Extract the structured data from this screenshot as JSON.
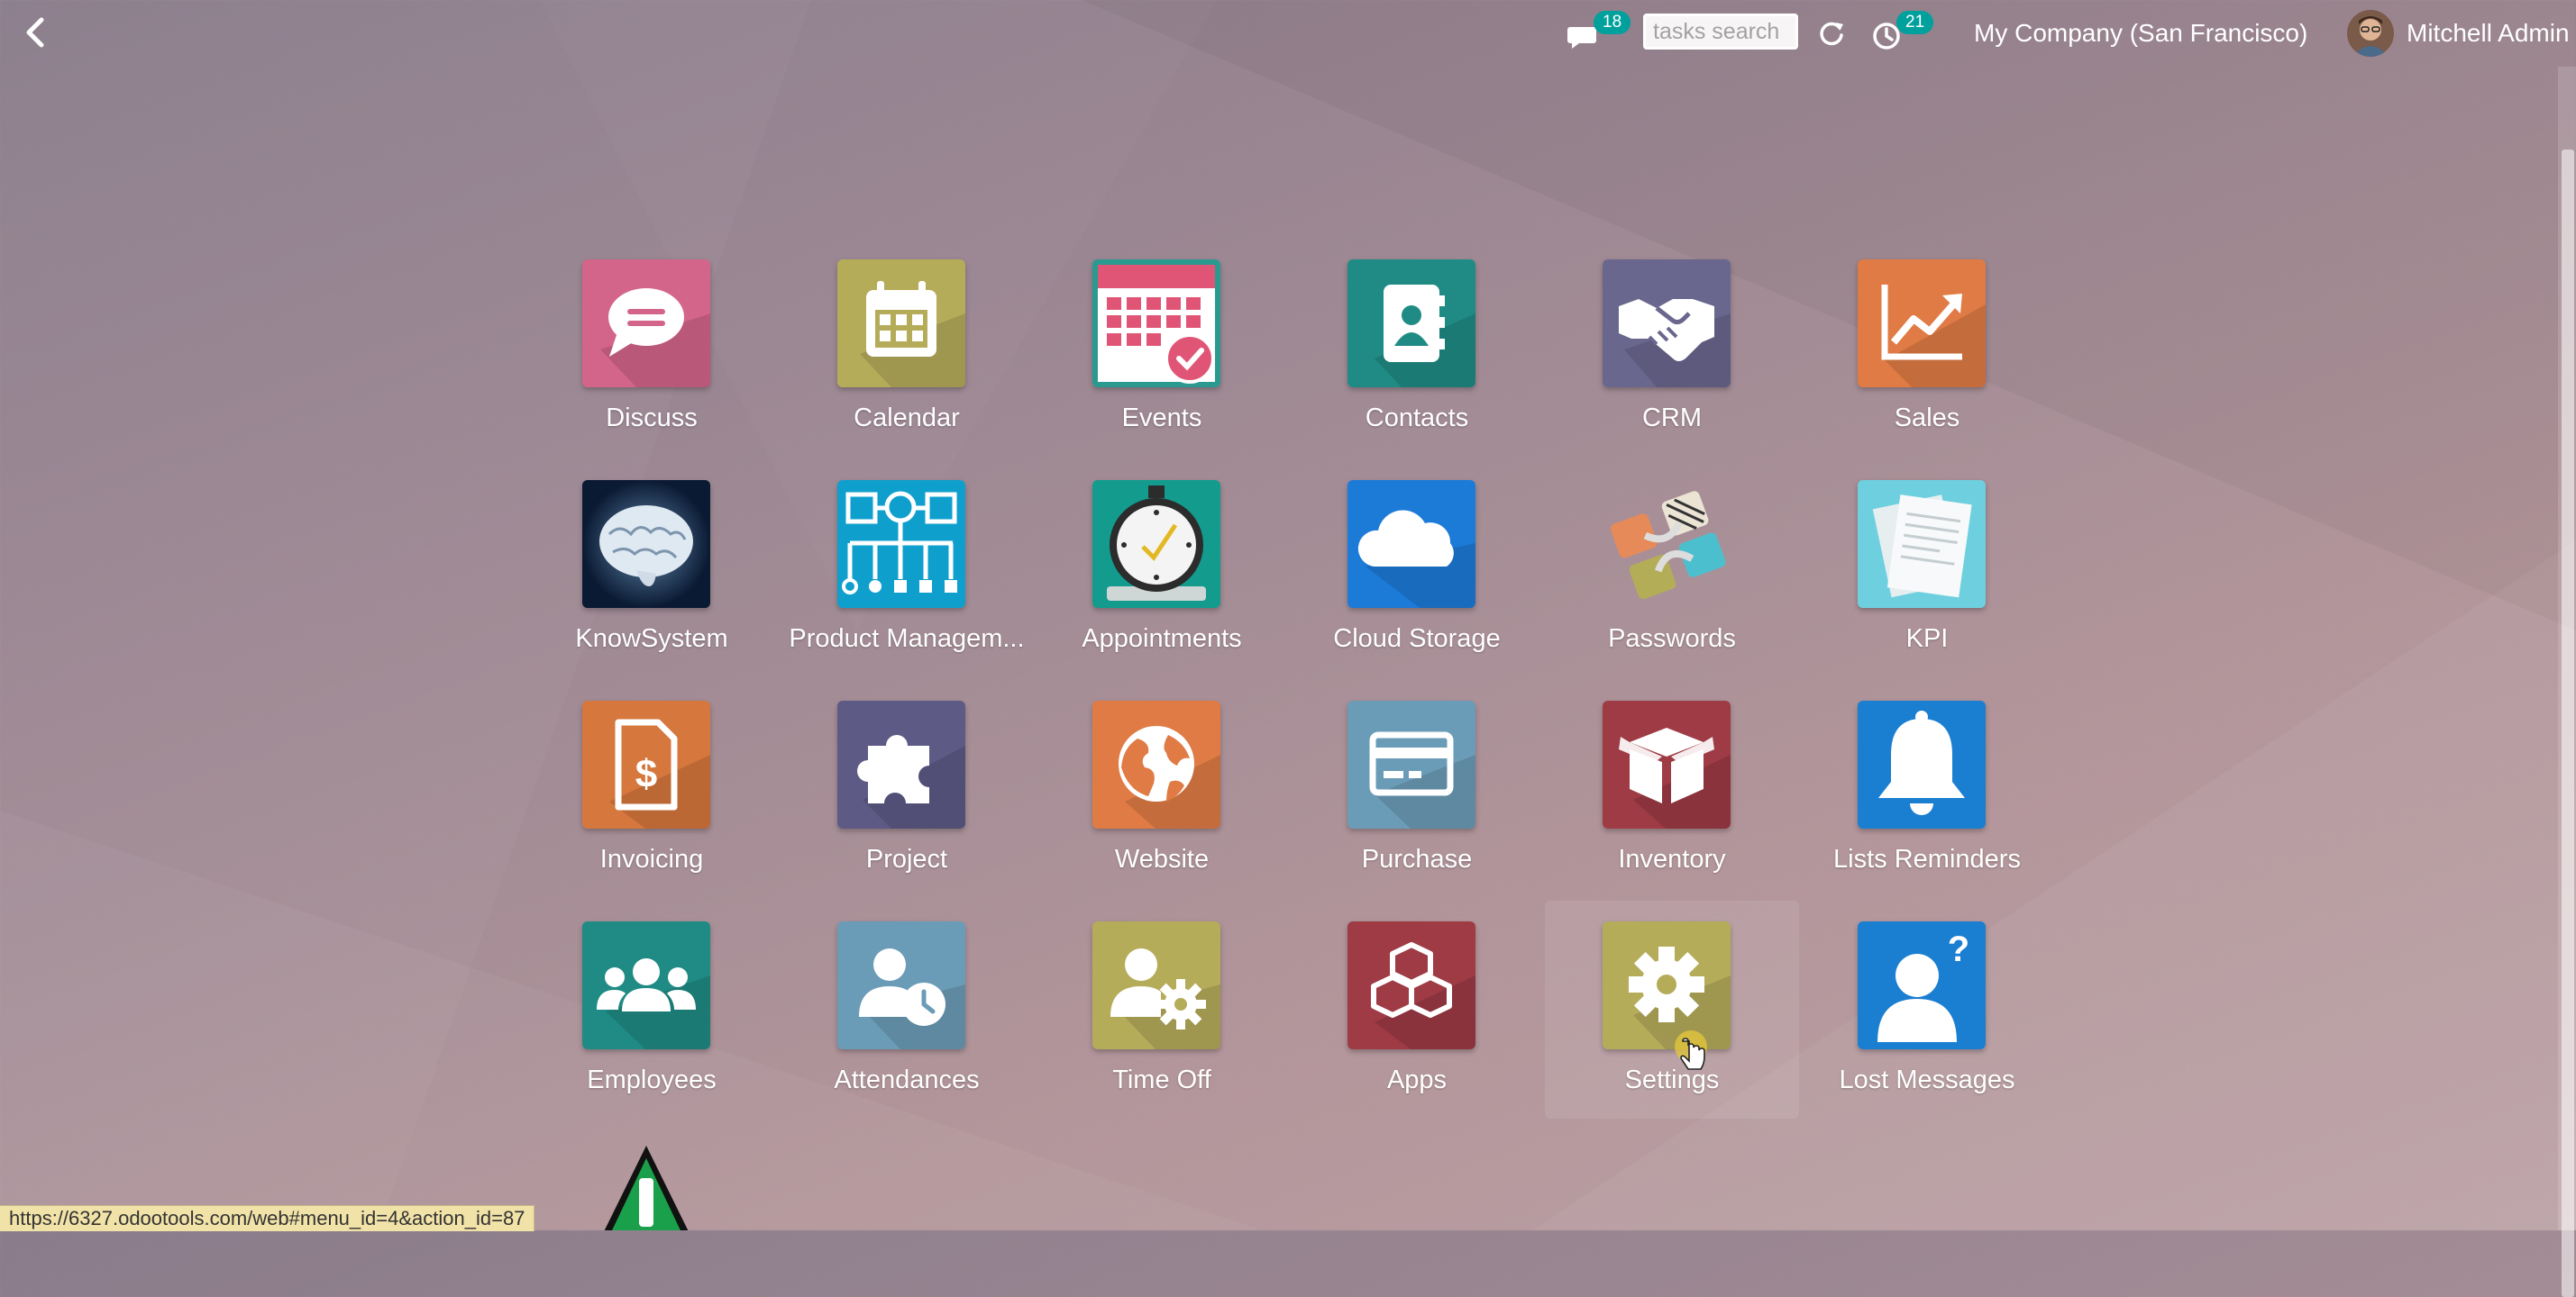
{
  "topbar": {
    "messages_count": "18",
    "search_placeholder": "tasks search",
    "activities_count": "21",
    "company": "My Company (San Francisco)",
    "user_name": "Mitchell Admin"
  },
  "apps": [
    {
      "label": "Discuss",
      "icon": "chat-bubble-icon",
      "color": "#d4658a"
    },
    {
      "label": "Calendar",
      "icon": "calendar-icon",
      "color": "#b5ac5a"
    },
    {
      "label": "Events",
      "icon": "events-calendar-check-icon",
      "color": "#2a9a90"
    },
    {
      "label": "Contacts",
      "icon": "address-book-icon",
      "color": "#1f8b84"
    },
    {
      "label": "CRM",
      "icon": "handshake-icon",
      "color": "#6a678f"
    },
    {
      "label": "Sales",
      "icon": "trend-chart-icon",
      "color": "#e07b45"
    },
    {
      "label": "KnowSystem",
      "icon": "brain-icon",
      "color": "#0b1a33"
    },
    {
      "label": "Product Managem...",
      "icon": "hierarchy-diagram-icon",
      "color": "#0f9fcd"
    },
    {
      "label": "Appointments",
      "icon": "stopwatch-icon",
      "color": "#139b8e"
    },
    {
      "label": "Cloud Storage",
      "icon": "cloud-icon",
      "color": "#1d7bd8"
    },
    {
      "label": "Passwords",
      "icon": "passwords-locks-icon",
      "color": "transparent"
    },
    {
      "label": "KPI",
      "icon": "documents-icon",
      "color": "#6ed0df"
    },
    {
      "label": "Invoicing",
      "icon": "invoice-dollar-icon",
      "color": "#d6773d"
    },
    {
      "label": "Project",
      "icon": "puzzle-icon",
      "color": "#5d5a86"
    },
    {
      "label": "Website",
      "icon": "globe-icon",
      "color": "#e07b45"
    },
    {
      "label": "Purchase",
      "icon": "credit-card-icon",
      "color": "#6b9cb7"
    },
    {
      "label": "Inventory",
      "icon": "box-icon",
      "color": "#9e3b45"
    },
    {
      "label": "Lists Reminders",
      "icon": "bell-icon",
      "color": "#1a7ed1"
    },
    {
      "label": "Employees",
      "icon": "users-group-icon",
      "color": "#1f8b84"
    },
    {
      "label": "Attendances",
      "icon": "user-clock-icon",
      "color": "#6b9cb7"
    },
    {
      "label": "Time Off",
      "icon": "user-gear-icon",
      "color": "#b5ac5a"
    },
    {
      "label": "Apps",
      "icon": "cubes-icon",
      "color": "#9e3b45"
    },
    {
      "label": "Settings",
      "icon": "gear-icon",
      "color": "#b5ac5a"
    },
    {
      "label": "Lost Messages",
      "icon": "user-question-icon",
      "color": "#1a7ed1"
    }
  ],
  "partial_app": {
    "icon": "warning-triangle-icon",
    "color": "#1aa04a"
  },
  "statusbar": {
    "url": "https://6327.odootools.com/web#menu_id=4&action_id=87"
  }
}
